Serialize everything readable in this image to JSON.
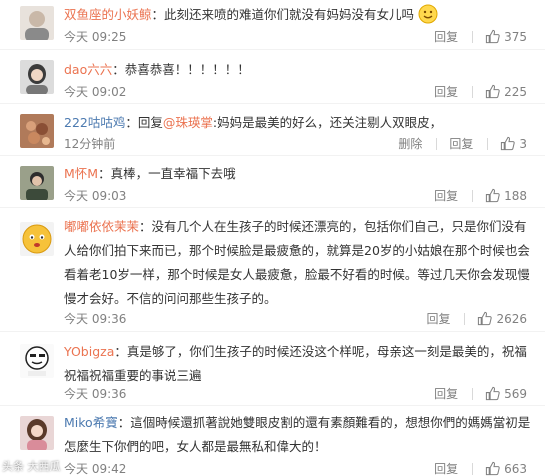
{
  "comments": [
    {
      "user": "双鱼座的小妖鲸",
      "text": "：此刻还来喷的难道你们就没有妈妈没有女儿吗",
      "time": "今天 09:25",
      "reply": "回复",
      "likes": "375"
    },
    {
      "user": "dao六六",
      "text": "：恭喜恭喜！！！！！！",
      "time": "今天 09:02",
      "reply": "回复",
      "likes": "225"
    },
    {
      "user": "222咕咕鸡",
      "text_prefix": "：回复",
      "mention": "@珠瑛掌",
      "text": ":妈妈是最美的好么，还关注剔人双眼皮，",
      "time": "12分钟前",
      "delete": "删除",
      "reply": "回复",
      "likes": "3"
    },
    {
      "user": "M怀M",
      "text": "：真棒，一直幸福下去哦",
      "time": "今天 09:03",
      "reply": "回复",
      "likes": "188"
    },
    {
      "user": "嘟嘟依依茉茉",
      "text": "：没有几个人在生孩子的时候还漂亮的，包括你们自己，只是你们没有人给你们拍下来而已，那个时候脸是最疲惫的，就算是20岁的小姑娘在那个时候也会看着老10岁一样，那个时候是女人最疲惫，脸最不好看的时候。等过几天你会发现慢慢才会好。不信的问问那些生孩子的。",
      "time": "今天 09:36",
      "reply": "回复",
      "likes": "2626"
    },
    {
      "user": "YObigza",
      "text": "：真是够了，你们生孩子的时候还没这个样呢，母亲这一刻是最美的，祝福祝福祝福重要的事说三遍",
      "time": "今天 09:36",
      "reply": "回复",
      "likes": "569"
    },
    {
      "user": "Miko希寶",
      "text": "：這個時候還抓著說她雙眼皮割的還有素顏難看的，想想你們的媽媽當初是怎麼生下你們的吧，女人都是最無私和偉大的！",
      "time": "今天 09:42",
      "reply": "回复",
      "likes": "663"
    }
  ],
  "watermark": "头条 大西瓜",
  "colors": {
    "username": "#eb7350",
    "mention": "#eb7350",
    "meta": "#808080"
  }
}
